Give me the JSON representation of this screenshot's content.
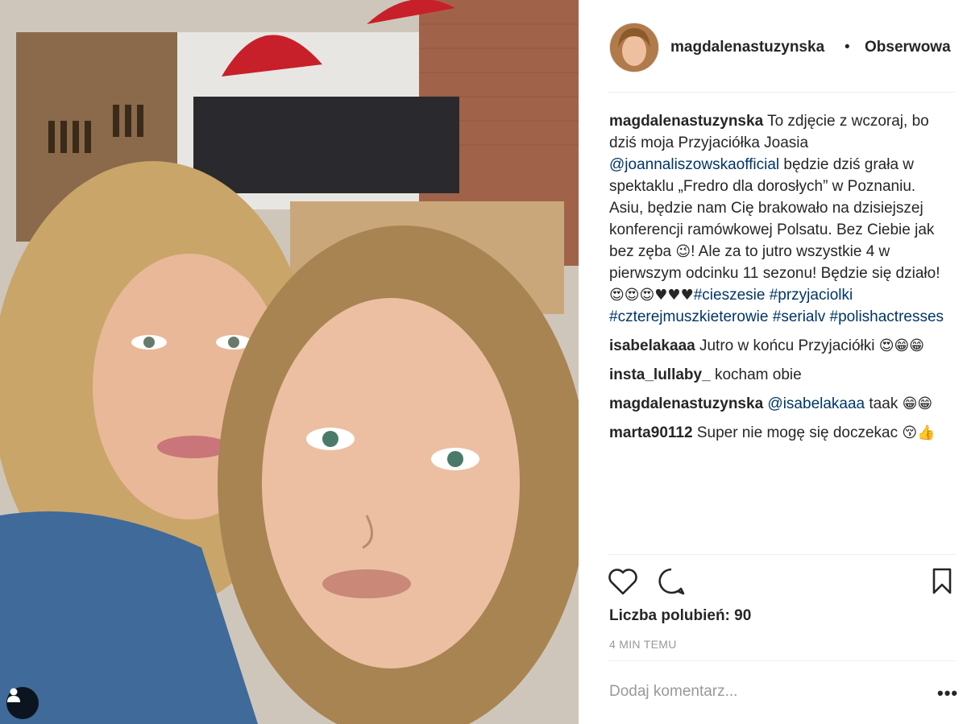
{
  "post": {
    "author": "magdalenastuzynska",
    "separator": "•",
    "follow_label": "Obserwowa",
    "caption": {
      "username": "magdalenastuzynska",
      "text1": " To zdjęcie z wczoraj, bo dziś moja Przyjaciółka Joasia ",
      "mention": "@joannaliszowskaofficial",
      "text2": " będzie dziś grała w spektaklu „Fredro dla dorosłych” w Poznaniu. Asiu, będzie nam Cię brakowało na dzisiejszej konferencji ramówkowej Polsatu. Bez Ciebie jak bez zęba ",
      "emoji1": "😉",
      "text3": "! Ale za to jutro wszystkie 4 w pierwszym odcinku 11 sezonu! Będzie się działo! ",
      "emoji2": "😍😍😍♥♥♥",
      "hashtags": [
        "#cieszesie",
        "#przyjaciolki",
        "#czterejmuszkieterowie",
        "#serialv",
        "#polishactresses"
      ]
    },
    "comments": [
      {
        "username": "isabelakaaa",
        "text": " Jutro w końcu Przyjaciółki ",
        "emoji": "😍😁😁"
      },
      {
        "username": "insta_lullaby_",
        "text": " kocham obie",
        "emoji": ""
      },
      {
        "username": "magdalenastuzynska",
        "mention": "@isabelakaaa",
        "text": " taak ",
        "emoji": "😁😁"
      },
      {
        "username": "marta90112",
        "text": " Super nie mogę się doczekac ",
        "emoji": "😚👍"
      }
    ],
    "likes_label": "Liczba polubień: 90",
    "timestamp": "4 MIN TEMU",
    "add_comment_placeholder": "Dodaj komentarz...",
    "more_label": "•••"
  },
  "icons": {
    "like": "heart-icon",
    "comment": "comment-icon",
    "save": "bookmark-icon",
    "user_tag": "user-tag-icon"
  },
  "colors": {
    "text": "#262626",
    "link": "#003569",
    "muted": "#999999",
    "divider": "#efefef"
  }
}
